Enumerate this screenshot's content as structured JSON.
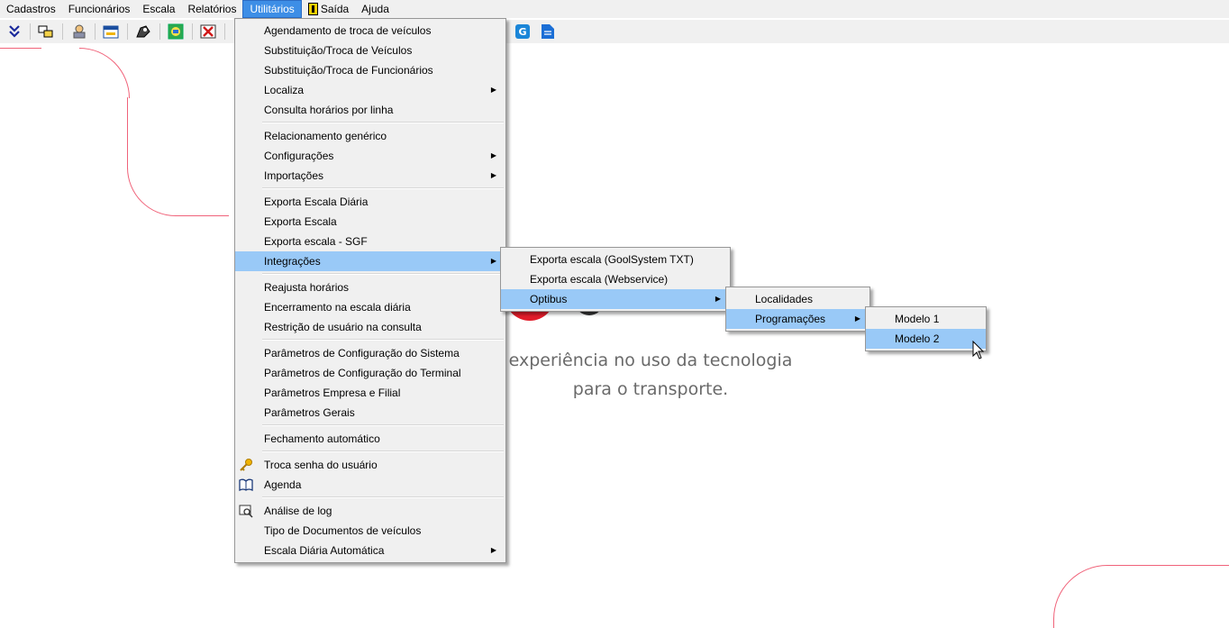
{
  "menubar": {
    "items": [
      "Cadastros",
      "Funcionários",
      "Escala",
      "Relatórios",
      "Utilitários",
      "Saída",
      "Ajuda"
    ],
    "active": "Utilitários"
  },
  "toolbar": {
    "icons": [
      "expand-down-icon",
      "vehicles-icon",
      "driver-icon",
      "calendar-icon",
      "hand-icon",
      "schedule-icon",
      "close-x-icon",
      "gool-icon",
      "document-icon"
    ]
  },
  "background": {
    "tagline_line1": "experiência no uso da tecnologia",
    "tagline_line2": "para o transporte.",
    "accent_color": "#f0637a"
  },
  "utilitarios_menu": {
    "items": [
      {
        "label": "Agendamento de troca de veículos"
      },
      {
        "label": "Substituição/Troca de Veículos"
      },
      {
        "label": "Substituição/Troca de Funcionários"
      },
      {
        "label": "Localiza",
        "submenu": true
      },
      {
        "label": "Consulta horários por linha"
      },
      {
        "label": "Relacionamento genérico"
      },
      {
        "label": "Configurações",
        "submenu": true
      },
      {
        "label": "Importações",
        "submenu": true
      },
      {
        "label": "Exporta Escala Diária"
      },
      {
        "label": "Exporta Escala"
      },
      {
        "label": "Exporta escala - SGF"
      },
      {
        "label": "Integrações",
        "submenu": true,
        "highlighted": true
      },
      {
        "label": "Reajusta horários"
      },
      {
        "label": "Encerramento na escala diária"
      },
      {
        "label": "Restrição de usuário na consulta"
      },
      {
        "label": "Parâmetros de Configuração do Sistema"
      },
      {
        "label": "Parâmetros de Configuração do Terminal"
      },
      {
        "label": "Parâmetros Empresa e Filial"
      },
      {
        "label": "Parâmetros Gerais"
      },
      {
        "label": "Fechamento automático"
      },
      {
        "label": "Troca senha do usuário",
        "icon": "key-icon"
      },
      {
        "label": "Agenda",
        "icon": "book-icon"
      },
      {
        "label": "Análise de log",
        "icon": "log-search-icon"
      },
      {
        "label": "Tipo de Documentos de veículos"
      },
      {
        "label": "Escala Diária Automática",
        "submenu": true
      }
    ]
  },
  "integracoes_menu": {
    "items": [
      {
        "label": "Exporta escala (GoolSystem TXT)"
      },
      {
        "label": "Exporta escala (Webservice)"
      },
      {
        "label": "Optibus",
        "submenu": true,
        "highlighted": true
      }
    ]
  },
  "optibus_menu": {
    "items": [
      {
        "label": "Localidades"
      },
      {
        "label": "Programações",
        "submenu": true,
        "highlighted": true
      }
    ]
  },
  "programacoes_menu": {
    "items": [
      {
        "label": "Modelo 1"
      },
      {
        "label": "Modelo 2",
        "highlighted": true
      }
    ]
  }
}
